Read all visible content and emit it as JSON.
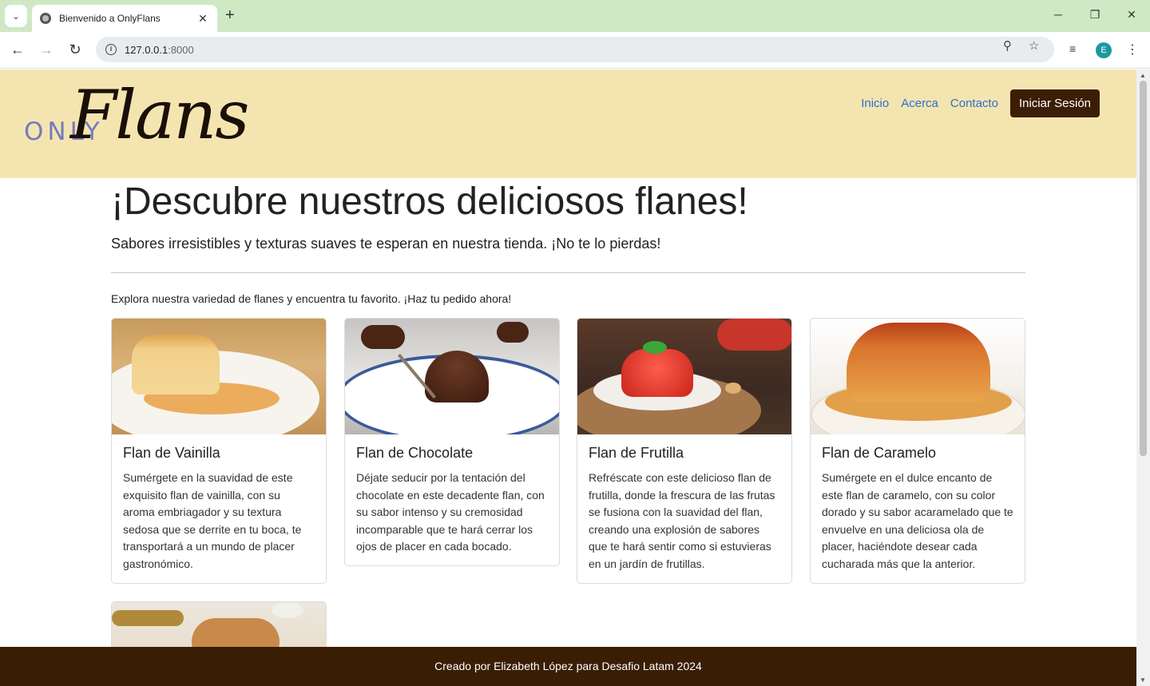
{
  "browser": {
    "tab_title": "Bienvenido a OnlyFlans",
    "url_host": "127.0.0.1",
    "url_port": ":8000",
    "profile_initial": "E"
  },
  "header": {
    "logo_only": "ONLY",
    "logo_flans": "Flans",
    "nav": {
      "inicio": "Inicio",
      "acerca": "Acerca",
      "contacto": "Contacto",
      "login": "Iniciar Sesión"
    }
  },
  "hero": {
    "title": "¡Descubre nuestros deliciosos flanes!",
    "lead": "Sabores irresistibles y texturas suaves te esperan en nuestra tienda. ¡No te lo pierdas!",
    "intro": "Explora nuestra variedad de flanes y encuentra tu favorito. ¡Haz tu pedido ahora!"
  },
  "cards": [
    {
      "title": "Flan de Vainilla",
      "text": "Sumérgete en la suavidad de este exquisito flan de vainilla, con su aroma embriagador y su textura sedosa que se derrite en tu boca, te transportará a un mundo de placer gastronómico."
    },
    {
      "title": "Flan de Chocolate",
      "text": "Déjate seducir por la tentación del chocolate en este decadente flan, con su sabor intenso y su cremosidad incomparable que te hará cerrar los ojos de placer en cada bocado."
    },
    {
      "title": "Flan de Frutilla",
      "text": "Refréscate con este delicioso flan de frutilla, donde la frescura de las frutas se fusiona con la suavidad del flan, creando una explosión de sabores que te hará sentir como si estuvieras en un jardín de frutillas."
    },
    {
      "title": "Flan de Caramelo",
      "text": "Sumérgete en el dulce encanto de este flan de caramelo, con su color dorado y su sabor acaramelado que te envuelve en una deliciosa ola de placer, haciéndote desear cada cucharada más que la anterior."
    }
  ],
  "footer": {
    "text": "Creado por Elizabeth López para Desafio Latam 2024"
  },
  "colors": {
    "header_bg": "#f4e5b0",
    "brand_dark": "#3a1e04",
    "link": "#2c6fd1",
    "logo_only": "#7779c0"
  }
}
